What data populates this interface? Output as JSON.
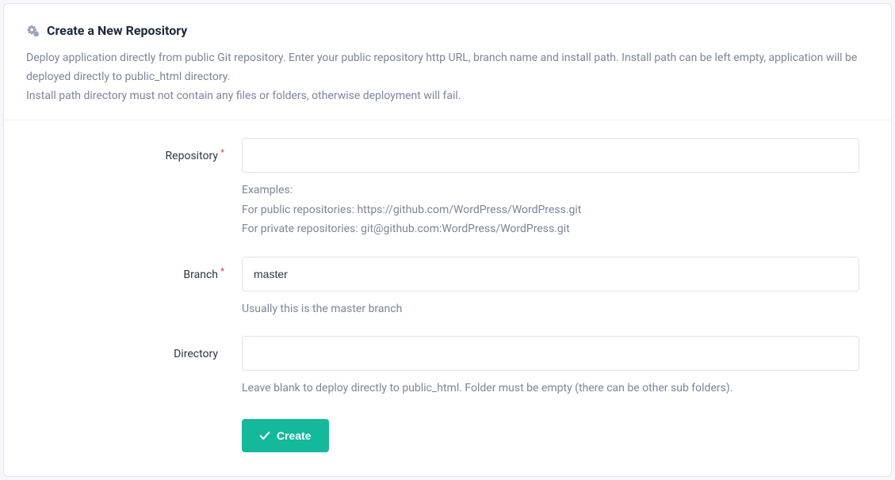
{
  "header": {
    "title": "Create a New Repository",
    "description_line1": "Deploy application directly from public Git repository. Enter your public repository http URL, branch name and install path. Install path can be left empty, application will be deployed directly to public_html directory.",
    "description_line2": "Install path directory must not contain any files or folders, otherwise deployment will fail."
  },
  "form": {
    "repository": {
      "label": "Repository",
      "value": "",
      "help_intro": "Examples:",
      "help_public": "For public repositories: https://github.com/WordPress/WordPress.git",
      "help_private": "For private repositories: git@github.com:WordPress/WordPress.git"
    },
    "branch": {
      "label": "Branch",
      "value": "master",
      "help": "Usually this is the master branch"
    },
    "directory": {
      "label": "Directory",
      "value": "",
      "help": "Leave blank to deploy directly to public_html. Folder must be empty (there can be other sub folders)."
    },
    "create_button": "Create"
  }
}
